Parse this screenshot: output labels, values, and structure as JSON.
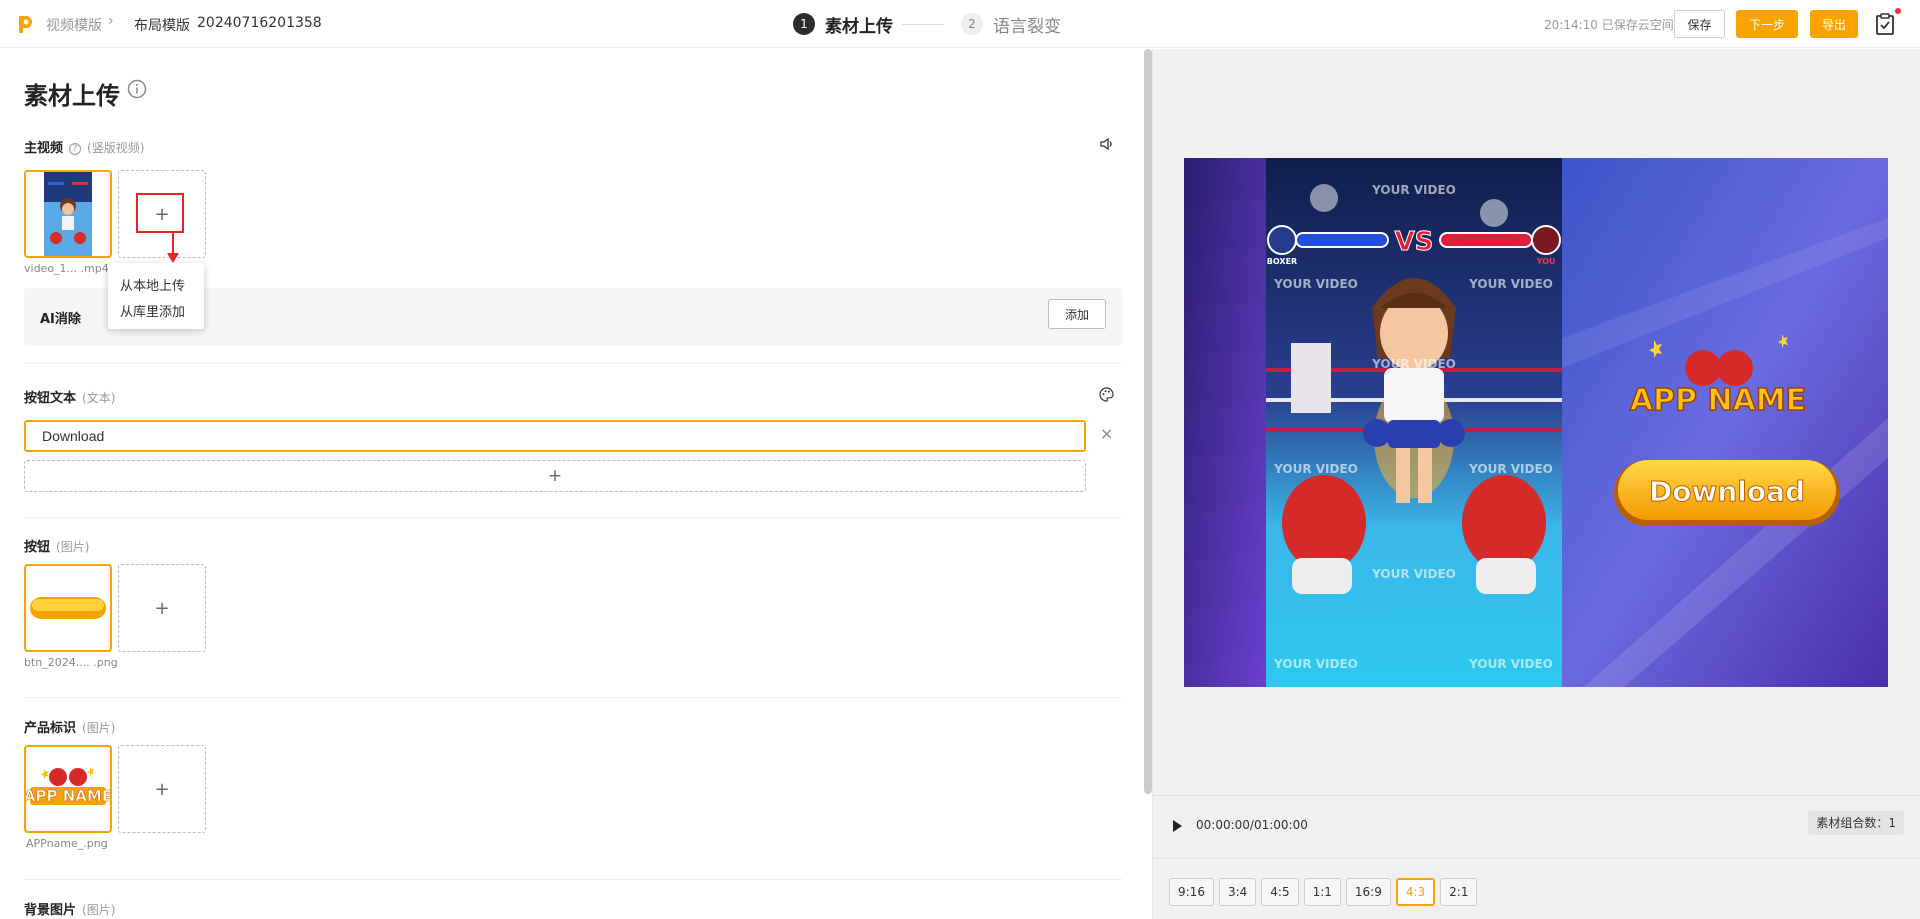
{
  "header": {
    "breadcrumb": [
      "视频模版",
      "布局模版",
      "20240716201358"
    ],
    "steps": [
      {
        "num": "1",
        "label": "素材上传"
      },
      {
        "num": "2",
        "label": "语言裂变"
      }
    ],
    "save_status": "20:14:10 已保存云空间",
    "save_label": "保存",
    "next_label": "下一步",
    "export_label": "导出"
  },
  "left": {
    "title": "素材上传",
    "main_video": {
      "title": "主视频",
      "subtitle": "(竖版视频)",
      "file": "video_1... .mp4",
      "upload_menu": [
        "从本地上传",
        "从库里添加"
      ]
    },
    "ai": {
      "label": "AI消除",
      "add_label": "添加"
    },
    "button_text": {
      "title": "按钮文本",
      "subtitle": "(文本)",
      "value": "Download",
      "add": "+"
    },
    "button": {
      "title": "按钮",
      "subtitle": "(图片)",
      "file": "btn_2024.... .png"
    },
    "logo": {
      "title": "产品标识",
      "subtitle": "(图片)",
      "file": "APPname_.png"
    },
    "background": {
      "title": "背景图片",
      "subtitle": "(图片)"
    }
  },
  "preview": {
    "watermark": "YOUR VIDEO",
    "app_name": "APP NAME",
    "download": "Download",
    "vs": "VS",
    "player_left": "BOXER",
    "player_right": "YOU",
    "time": "00:00:00/01:00:00",
    "combo": "素材组合数：1",
    "ratios": [
      "9:16",
      "3:4",
      "4:5",
      "1:1",
      "16:9",
      "4:3",
      "2:1"
    ],
    "active_ratio": "4:3"
  },
  "colors": {
    "accent": "#f8a300",
    "highlight": "#e22222"
  }
}
